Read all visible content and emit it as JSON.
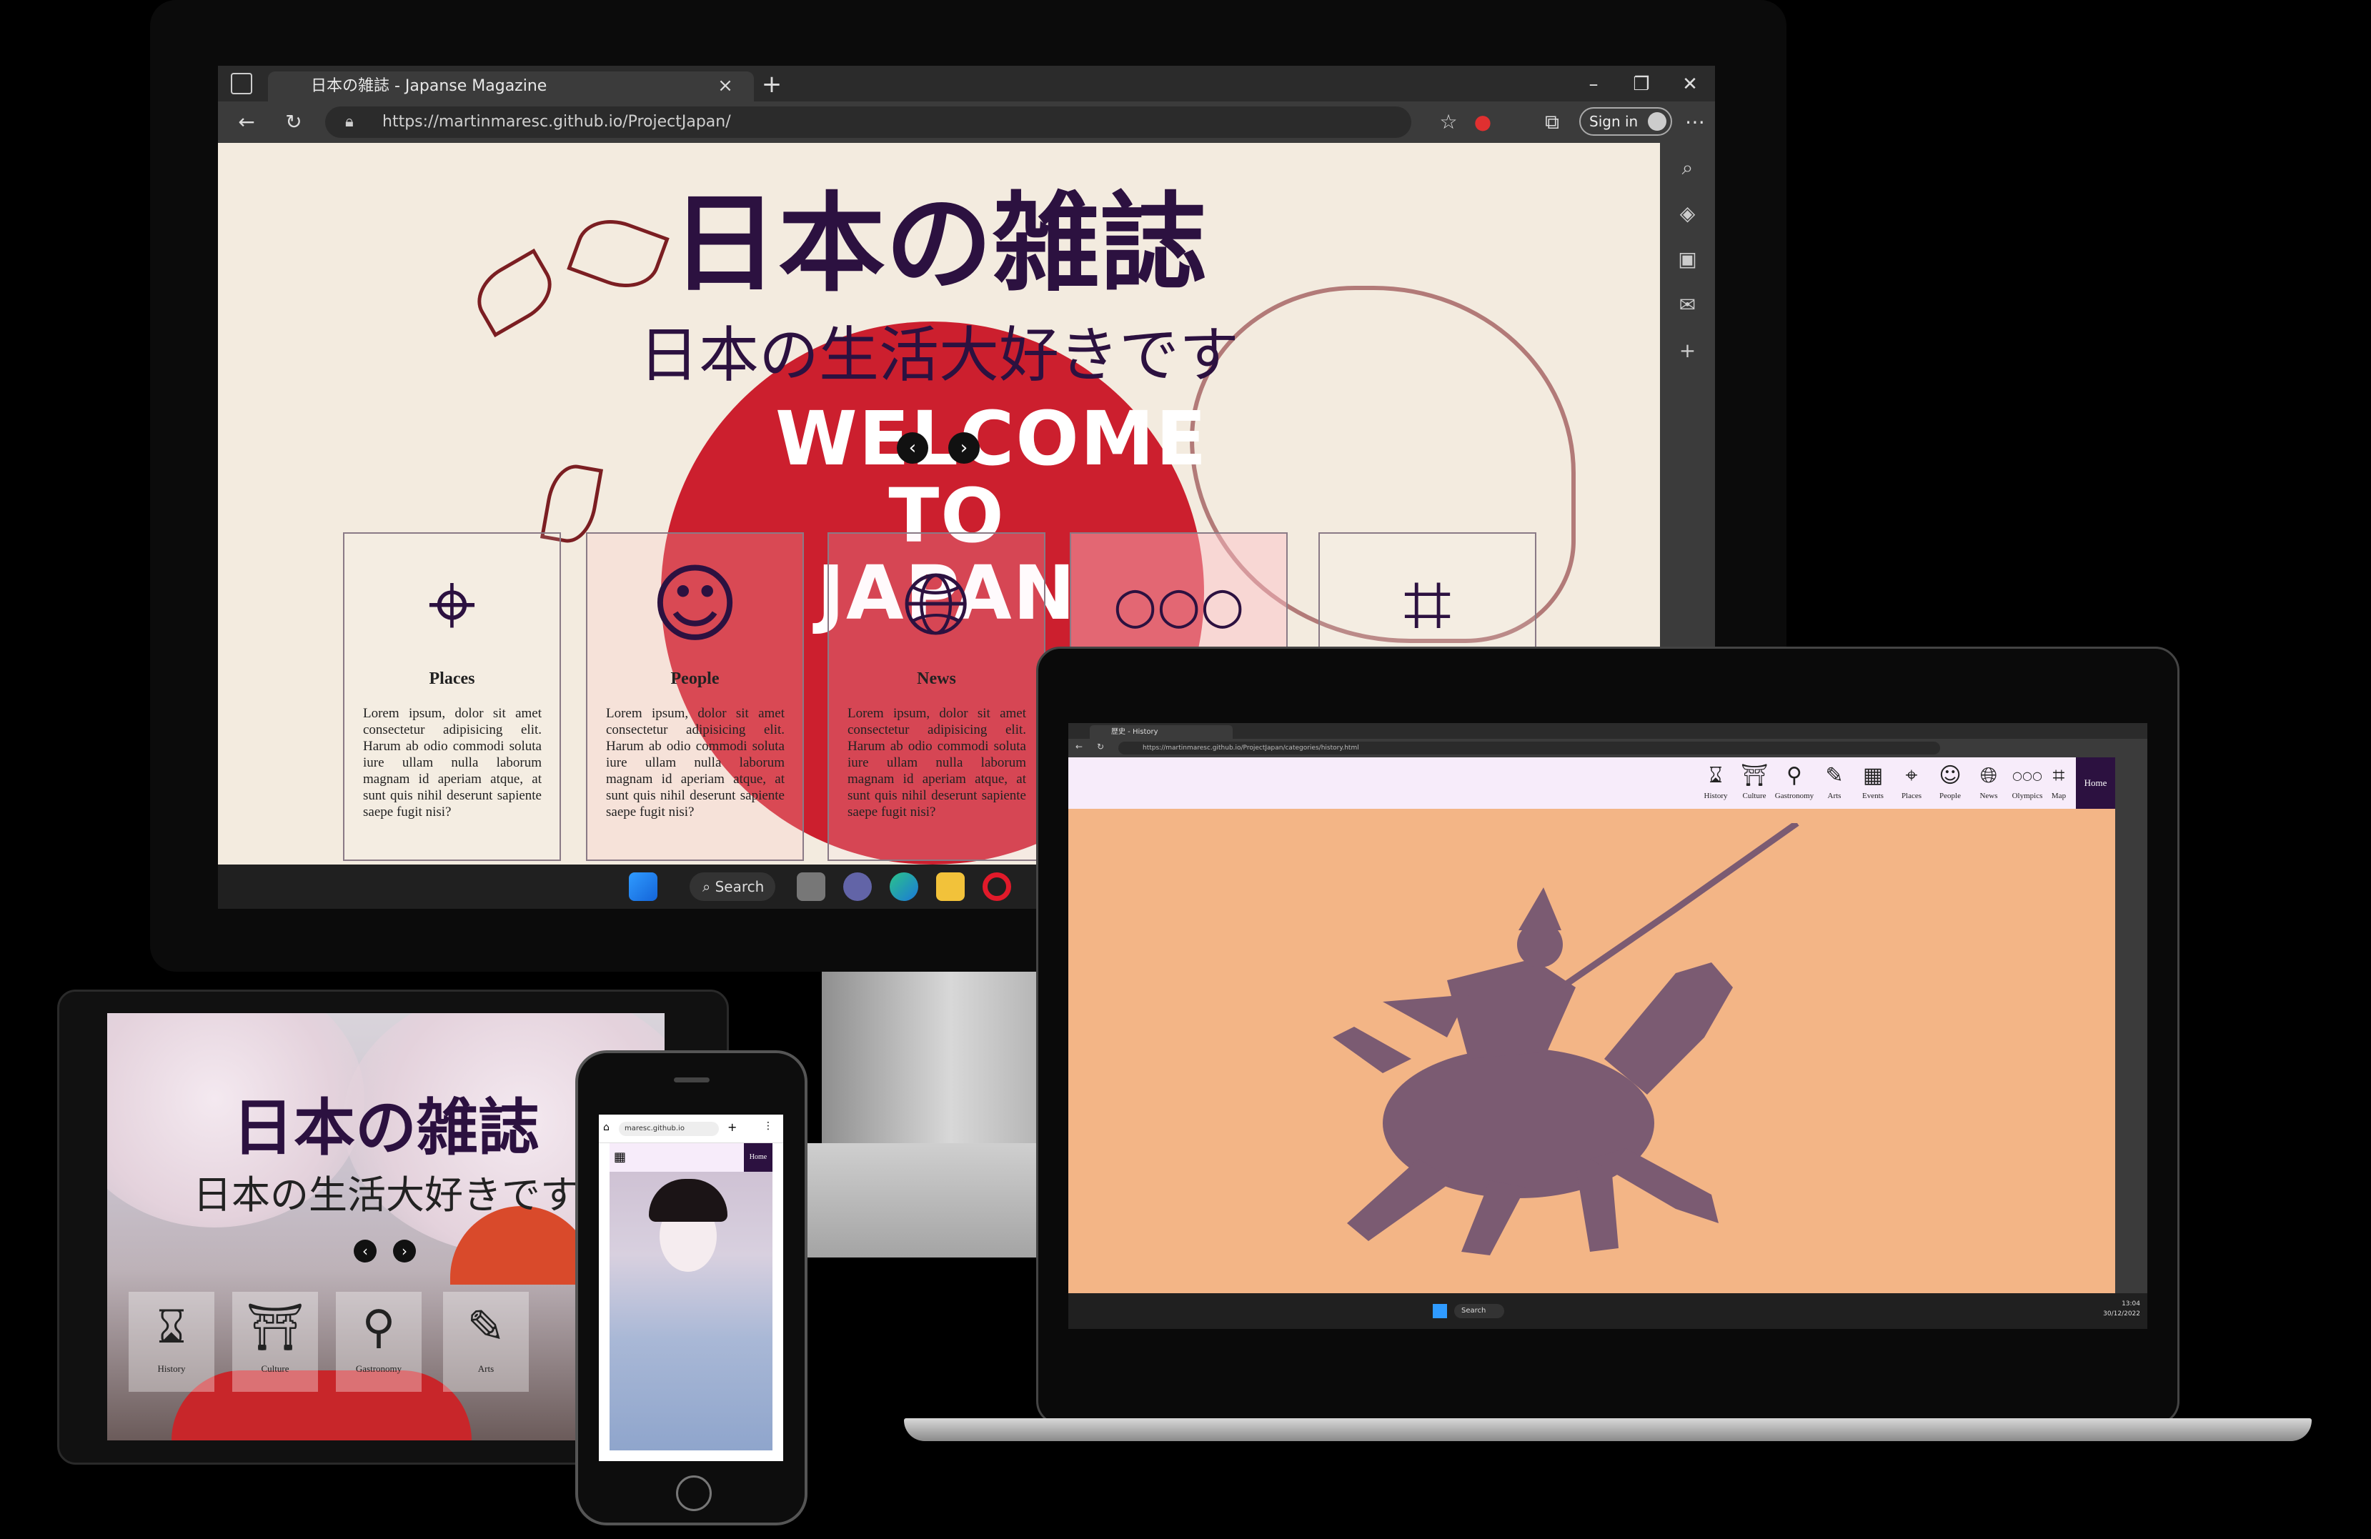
{
  "monitor": {
    "browser": {
      "tab_title": "日本の雑誌 - Japanse Magazine",
      "url": "https://martinmaresc.github.io/ProjectJapan/",
      "sign_in_label": "Sign in"
    },
    "page": {
      "title": "日本の雑誌",
      "subtitle": "日本の生活大好きです",
      "banner_line1": "WELCOME",
      "banner_line2": "TO JAPAN",
      "cards": [
        {
          "title": "Places",
          "icon": "map-pin-icon",
          "text": "Lorem ipsum, dolor sit amet consectetur adipisicing elit. Harum ab odio commodi soluta iure ullam nulla laborum magnam id aperiam atque, at sunt quis nihil deserunt sapiente saepe fugit nisi?"
        },
        {
          "title": "People",
          "icon": "person-icon",
          "text": "Lorem ipsum, dolor sit amet consectetur adipisicing elit. Harum ab odio commodi soluta iure ullam nulla laborum magnam id aperiam atque, at sunt quis nihil deserunt sapiente saepe fugit nisi?"
        },
        {
          "title": "News",
          "icon": "news-globe-icon",
          "text": "Lorem ipsum, dolor sit amet consectetur adipisicing elit. Harum ab odio commodi soluta iure ullam nulla laborum magnam id aperiam atque, at sunt quis nihil deserunt sapiente saepe fugit nisi?"
        },
        {
          "title": "",
          "icon": "olympic-rings-icon",
          "text": ""
        },
        {
          "title": "",
          "icon": "map-icon",
          "text": ""
        }
      ]
    },
    "taskbar": {
      "search_label": "Search"
    }
  },
  "laptop": {
    "browser": {
      "tab_title": "歴史 - History",
      "url": "https://martinmaresc.github.io/ProjectJapan/categories/history.html"
    },
    "nav": [
      {
        "label": "History",
        "icon": "hourglass-icon"
      },
      {
        "label": "Culture",
        "icon": "pagoda-icon"
      },
      {
        "label": "Gastronomy",
        "icon": "food-icon"
      },
      {
        "label": "Arts",
        "icon": "arts-icon"
      },
      {
        "label": "Events",
        "icon": "calendar-icon"
      },
      {
        "label": "Places",
        "icon": "map-pin-icon"
      },
      {
        "label": "People",
        "icon": "person-icon"
      },
      {
        "label": "News",
        "icon": "globe-icon"
      },
      {
        "label": "Olympics",
        "icon": "olympic-rings-icon"
      },
      {
        "label": "Map",
        "icon": "map-icon"
      }
    ],
    "home_label": "Home",
    "taskbar": {
      "search_label": "Search",
      "time": "13:04",
      "date": "30/12/2022"
    }
  },
  "tablet": {
    "title": "日本の雑誌",
    "subtitle": "日本の生活大好きです",
    "nav": [
      {
        "label": "History",
        "icon": "hourglass-icon"
      },
      {
        "label": "Culture",
        "icon": "pagoda-icon"
      },
      {
        "label": "Gastronomy",
        "icon": "food-icon"
      },
      {
        "label": "Arts",
        "icon": "arts-icon"
      }
    ]
  },
  "phone": {
    "url": "maresc.github.io",
    "home_label": "Home"
  },
  "colors": {
    "brand_purple": "#2c1140",
    "sun_red": "#cc1f2e",
    "history_bg": "#f3b586",
    "nav_bg": "#f7ecfa"
  }
}
